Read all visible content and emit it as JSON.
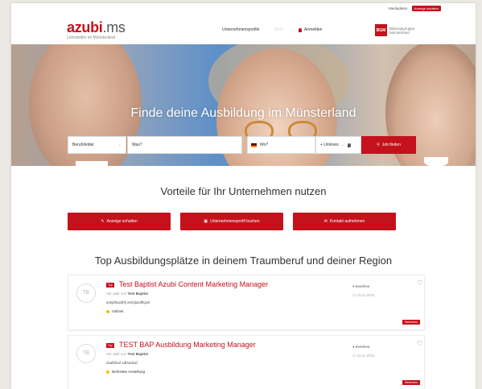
{
  "topbar": {
    "media_label": "Mediadaten",
    "cta_label": "Anzeige schalten"
  },
  "logo": {
    "brand": "azubi",
    "tld": ".ms",
    "tagline": "Lehrstellen im Münsterland"
  },
  "nav": {
    "company_profiles": "Unternehmensprofile",
    "hidden_item": "Stelle",
    "login": "Anmelden"
  },
  "partner": {
    "mark": "BGM",
    "line1": "Bildungsgruppe",
    "line2": "Münsterland"
  },
  "hero": {
    "title": "Finde deine Ausbildung im Münsterland"
  },
  "search": {
    "category_placeholder": "Berufsfelder",
    "what_placeholder": "Was?",
    "where_placeholder": "Wo?",
    "radius_label": "+ Umkreis",
    "submit_label": "Job finden"
  },
  "benefits": {
    "heading": "Vorteile für Ihr Unternehmen nutzen",
    "buttons": [
      "Anzeige schalten",
      "Unternehmensprofil buchen",
      "Kontakt aufnehmen"
    ]
  },
  "top_section": {
    "heading": "Top Ausbildungsplätze in deinem Traumberuf und deiner Region"
  },
  "jobs": [
    {
      "initials": "TB",
      "badge": "Top",
      "title": "Test Baptist Azubi Content Marketing Manager",
      "by_prefix": "Vor Jahr von",
      "company": "Test Baptist",
      "snippet": "askjdfasjdhfj ashdjasdfkjasl",
      "tag": "Vollzeit",
      "location": "Everleve",
      "date": "13.11.2023",
      "apply": "Bewerben"
    },
    {
      "initials": "TB",
      "badge": "Top",
      "title": "TEST BAP Ausbildung Marketing Manager",
      "by_prefix": "Vor Jahr von",
      "company": "Test Baptist",
      "snippet": "dsaffdsaf sdfsadsaf",
      "tag": "Befristete Anstellung",
      "location": "Everleve",
      "date": "13.11.2023",
      "apply": "Bewerben"
    }
  ],
  "colors": {
    "accent": "#c4121c"
  }
}
